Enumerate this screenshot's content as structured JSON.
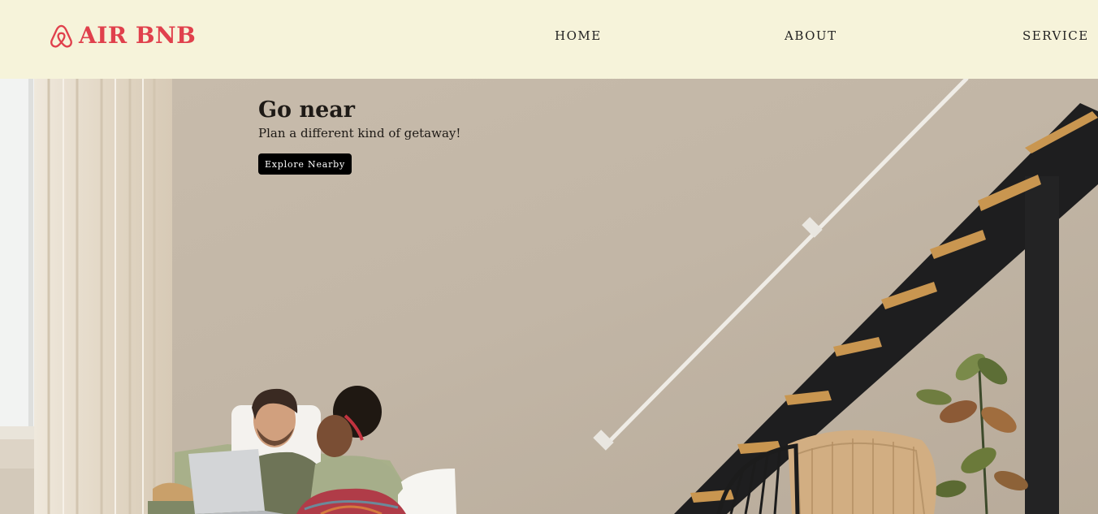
{
  "header": {
    "brand_name": "AIR BNB",
    "brand_color": "#e0404c",
    "background": "#f6f3da",
    "logo_icon": "airbnb-belo-icon",
    "nav": {
      "home": "HOME",
      "about": "ABOUT",
      "service": "SERVICE"
    }
  },
  "hero": {
    "title": "Go near",
    "subtitle": "Plan a different kind of getaway!",
    "cta_label": "Explore Nearby"
  }
}
